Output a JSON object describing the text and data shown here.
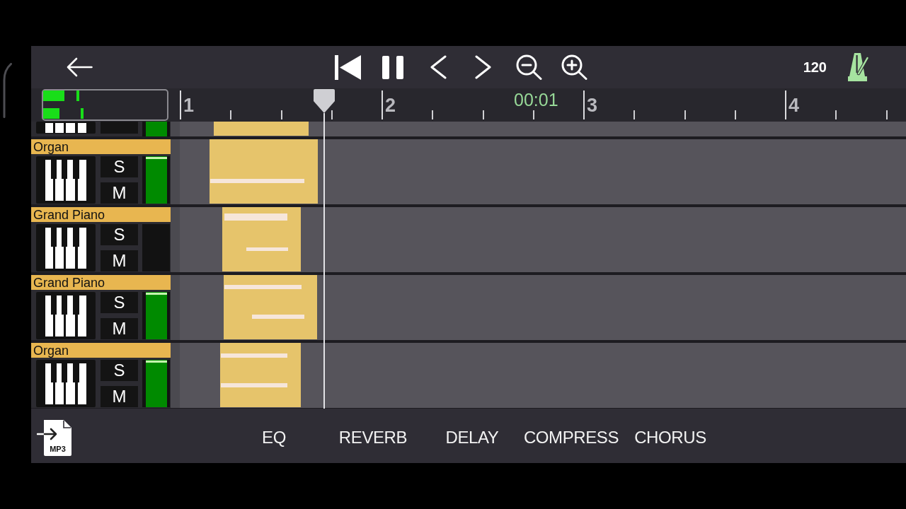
{
  "transport": {
    "playing": true
  },
  "tempo": "120",
  "master_meter": {
    "channels": [
      {
        "level": 0.17
      },
      {
        "level": 0.13
      }
    ]
  },
  "ruler": {
    "bars": [
      "1",
      "2",
      "3",
      "4"
    ],
    "time": "00:01"
  },
  "tracks": [
    {
      "name": "Organ",
      "solo_label": "S",
      "mute_label": "M",
      "level": 1
    },
    {
      "name": "Grand Piano",
      "solo_label": "S",
      "mute_label": "M",
      "level": 0
    },
    {
      "name": "Grand Piano",
      "solo_label": "S",
      "mute_label": "M",
      "level": 1
    },
    {
      "name": "Organ",
      "solo_label": "S",
      "mute_label": "M",
      "level": 1
    }
  ],
  "export_button": {
    "label": "MP3"
  },
  "effects": [
    {
      "label": "EQ"
    },
    {
      "label": "REVERB"
    },
    {
      "label": "DELAY"
    },
    {
      "label": "COMPRESS"
    },
    {
      "label": "CHORUS"
    }
  ]
}
